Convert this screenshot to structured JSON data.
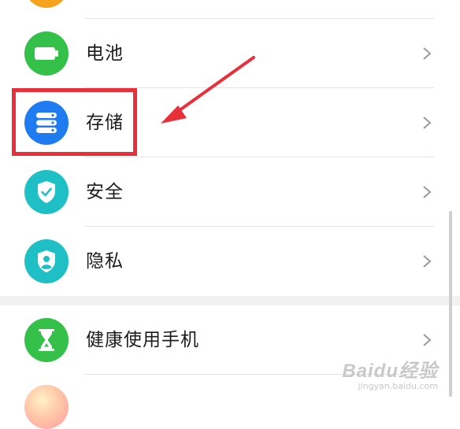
{
  "settings": {
    "items": [
      {
        "label": "电池",
        "icon": "battery-icon",
        "color": "#35c04a"
      },
      {
        "label": "存储",
        "icon": "storage-icon",
        "color": "#1f7cf0"
      },
      {
        "label": "安全",
        "icon": "shield-check-icon",
        "color": "#1fc0c5"
      },
      {
        "label": "隐私",
        "icon": "privacy-icon",
        "color": "#1fc0c5"
      },
      {
        "label": "健康使用手机",
        "icon": "hourglass-icon",
        "color": "#35c04a"
      }
    ]
  },
  "annotation": {
    "highlight_color": "#e8303a",
    "target": "存储"
  },
  "watermark": {
    "main": "Baidu经验",
    "sub": "jingyan.baidu.com"
  }
}
